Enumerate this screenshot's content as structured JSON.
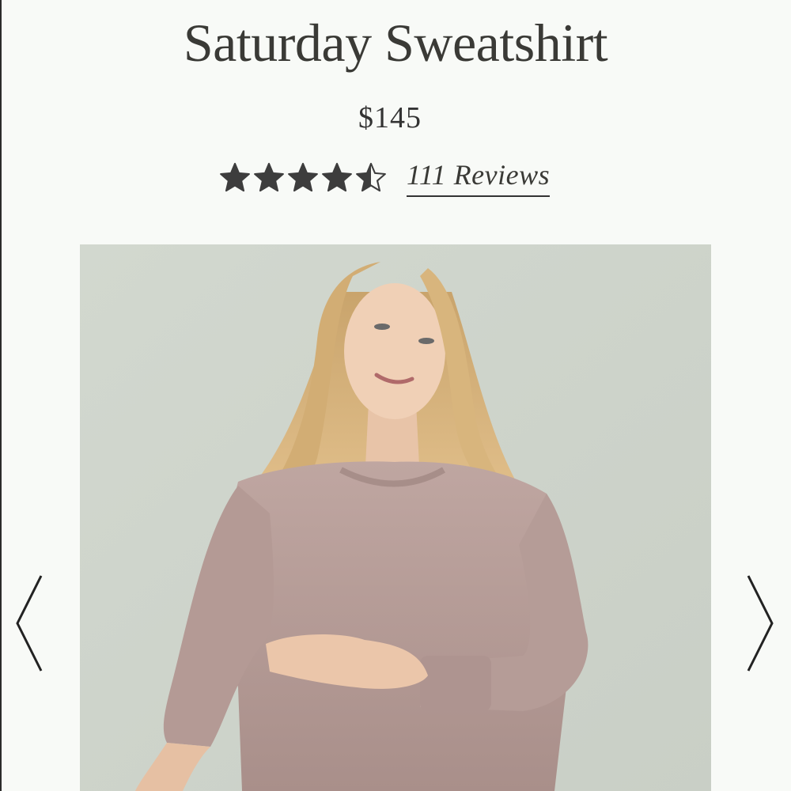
{
  "product": {
    "title": "Saturday Sweatshirt",
    "price": "$145",
    "rating": 4.5,
    "rating_max": 5,
    "reviews_label": "111 Reviews"
  },
  "gallery": {
    "image_icon": "product-photo",
    "prev_icon": "chevron-left-icon",
    "next_icon": "chevron-right-icon"
  },
  "colors": {
    "background": "#f8faf7",
    "text": "#333333",
    "star": "#3d3d3d",
    "photo_backdrop": "#d4dad2",
    "sweatshirt": "#b9a09b",
    "hair": "#d4b07a"
  }
}
